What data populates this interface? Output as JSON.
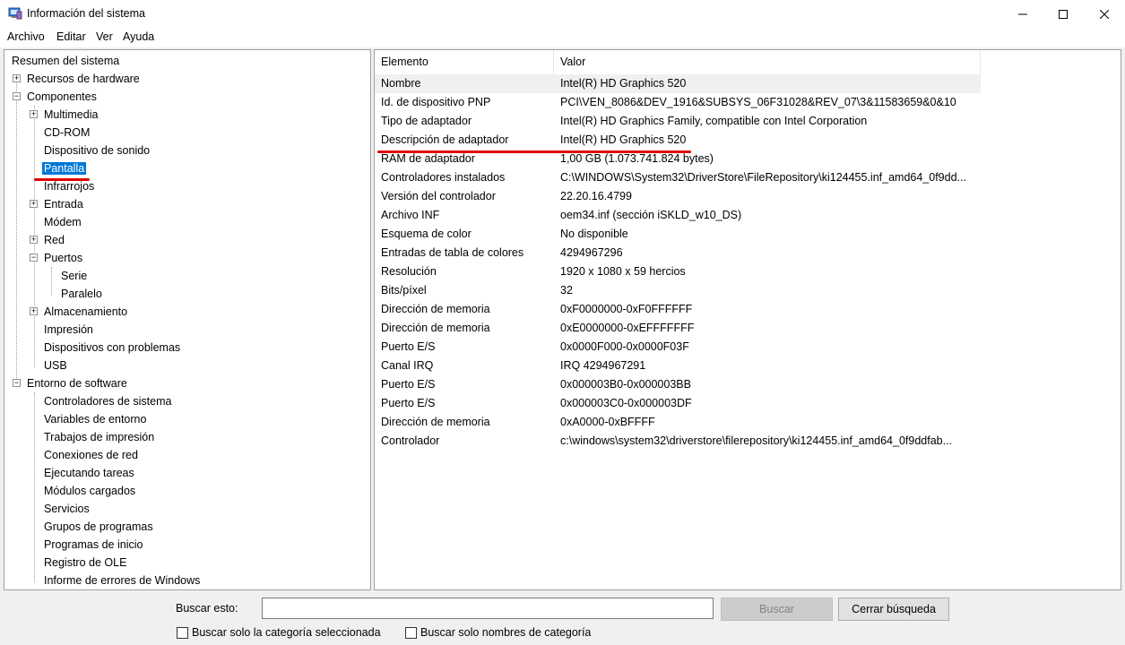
{
  "window": {
    "title": "Información del sistema",
    "controls": {
      "minimize": "—",
      "maximize": "☐",
      "close": "✕"
    }
  },
  "menu": [
    "Archivo",
    "Editar",
    "Ver",
    "Ayuda"
  ],
  "tree": {
    "root": "Resumen del sistema",
    "selected": "Pantalla",
    "nodes": [
      {
        "label": "Recursos de hardware",
        "expander": "+"
      },
      {
        "label": "Componentes",
        "expander": "−"
      },
      {
        "label": "Multimedia",
        "expander": "+"
      },
      {
        "label": "CD-ROM"
      },
      {
        "label": "Dispositivo de sonido"
      },
      {
        "label": "Pantalla"
      },
      {
        "label": "Infrarrojos"
      },
      {
        "label": "Entrada",
        "expander": "+"
      },
      {
        "label": "Módem"
      },
      {
        "label": "Red",
        "expander": "+"
      },
      {
        "label": "Puertos",
        "expander": "−"
      },
      {
        "label": "Serie"
      },
      {
        "label": "Paralelo"
      },
      {
        "label": "Almacenamiento",
        "expander": "+"
      },
      {
        "label": "Impresión"
      },
      {
        "label": "Dispositivos con problemas"
      },
      {
        "label": "USB"
      },
      {
        "label": "Entorno de software",
        "expander": "−"
      },
      {
        "label": "Controladores de sistema"
      },
      {
        "label": "Variables de entorno"
      },
      {
        "label": "Trabajos de impresión"
      },
      {
        "label": "Conexiones de red"
      },
      {
        "label": "Ejecutando tareas"
      },
      {
        "label": "Módulos cargados"
      },
      {
        "label": "Servicios"
      },
      {
        "label": "Grupos de programas"
      },
      {
        "label": "Programas de inicio"
      },
      {
        "label": "Registro de OLE"
      },
      {
        "label": "Informe de errores de Windows"
      }
    ]
  },
  "details": {
    "columns": [
      "Elemento",
      "Valor"
    ],
    "rows": [
      [
        "Nombre",
        "Intel(R) HD Graphics 520"
      ],
      [
        "Id. de dispositivo PNP",
        "PCI\\VEN_8086&DEV_1916&SUBSYS_06F31028&REV_07\\3&11583659&0&10"
      ],
      [
        "Tipo de adaptador",
        "Intel(R) HD Graphics Family, compatible con Intel Corporation"
      ],
      [
        "Descripción de adaptador",
        "Intel(R) HD Graphics 520"
      ],
      [
        "RAM de adaptador",
        "1,00 GB (1.073.741.824 bytes)"
      ],
      [
        "Controladores instalados",
        "C:\\WINDOWS\\System32\\DriverStore\\FileRepository\\ki124455.inf_amd64_0f9dd..."
      ],
      [
        "Versión del controlador",
        "22.20.16.4799"
      ],
      [
        "Archivo INF",
        "oem34.inf (sección iSKLD_w10_DS)"
      ],
      [
        "Esquema de color",
        "No disponible"
      ],
      [
        "Entradas de tabla de colores",
        "4294967296"
      ],
      [
        "Resolución",
        "1920 x 1080 x 59 hercios"
      ],
      [
        "Bits/píxel",
        "32"
      ],
      [
        "Dirección de memoria",
        "0xF0000000-0xF0FFFFFF"
      ],
      [
        "Dirección de memoria",
        "0xE0000000-0xEFFFFFFF"
      ],
      [
        "Puerto E/S",
        "0x0000F000-0x0000F03F"
      ],
      [
        "Canal IRQ",
        "IRQ 4294967291"
      ],
      [
        "Puerto E/S",
        "0x000003B0-0x000003BB"
      ],
      [
        "Puerto E/S",
        "0x000003C0-0x000003DF"
      ],
      [
        "Dirección de memoria",
        "0xA0000-0xBFFFF"
      ],
      [
        "Controlador",
        "c:\\windows\\system32\\driverstore\\filerepository\\ki124455.inf_amd64_0f9ddfab..."
      ]
    ]
  },
  "search": {
    "label": "Buscar esto:",
    "value": "",
    "search_button": "Buscar",
    "close_button": "Cerrar búsqueda",
    "check_selected_category": "Buscar solo la categoría seleccionada",
    "check_category_names": "Buscar solo nombres de categoría"
  },
  "colors": {
    "selection": "#0078d7",
    "annotation_red": "#e00000"
  }
}
